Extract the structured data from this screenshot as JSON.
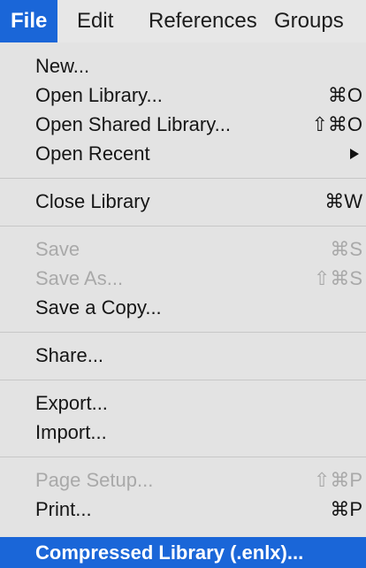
{
  "menubar": {
    "items": [
      {
        "label": "File"
      },
      {
        "label": "Edit"
      },
      {
        "label": "References"
      },
      {
        "label": "Groups"
      }
    ]
  },
  "file_menu": {
    "new": {
      "label": "New..."
    },
    "open_library": {
      "label": "Open Library...",
      "shortcut": "⌘O"
    },
    "open_shared_library": {
      "label": "Open Shared Library...",
      "shortcut": "⇧⌘O"
    },
    "open_recent": {
      "label": "Open Recent",
      "icon": "submenu-arrow-icon"
    },
    "close_library": {
      "label": "Close Library",
      "shortcut": "⌘W"
    },
    "save": {
      "label": "Save",
      "shortcut": "⌘S"
    },
    "save_as": {
      "label": "Save As...",
      "shortcut": "⇧⌘S"
    },
    "save_a_copy": {
      "label": "Save a Copy..."
    },
    "share": {
      "label": "Share..."
    },
    "export": {
      "label": "Export..."
    },
    "import": {
      "label": "Import..."
    },
    "page_setup": {
      "label": "Page Setup...",
      "shortcut": "⇧⌘P"
    },
    "print": {
      "label": "Print...",
      "shortcut": "⌘P"
    },
    "compressed_library": {
      "label": "Compressed Library (.enlx)..."
    }
  },
  "colors": {
    "highlight": "#1a66d8",
    "menu_background": "#e3e3e3",
    "disabled_text": "#a9a9a9"
  }
}
